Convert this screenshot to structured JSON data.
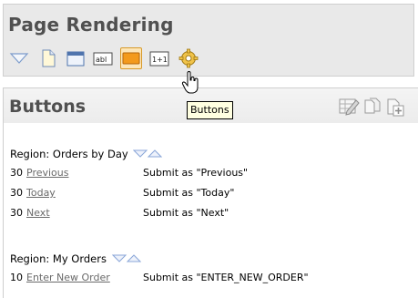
{
  "header": {
    "title": "Page Rendering"
  },
  "toolbar": {
    "items": [
      {
        "icon": "collapse-triangle-icon"
      },
      {
        "icon": "page-icon"
      },
      {
        "icon": "region-icon"
      },
      {
        "icon": "text-field-icon",
        "label": "abl"
      },
      {
        "icon": "button-icon"
      },
      {
        "icon": "computation-icon",
        "label": "1+1"
      },
      {
        "icon": "process-gear-icon"
      }
    ]
  },
  "tooltip": {
    "text": "Buttons"
  },
  "section": {
    "title": "Buttons"
  },
  "regions": [
    {
      "heading": "Region: Orders by Day",
      "buttons": [
        {
          "seq": "30",
          "name": "Previous",
          "action": "Submit as \"Previous\""
        },
        {
          "seq": "30",
          "name": "Today",
          "action": "Submit as \"Today\""
        },
        {
          "seq": "30",
          "name": "Next",
          "action": "Submit as \"Next\""
        }
      ]
    },
    {
      "heading": "Region: My Orders",
      "buttons": [
        {
          "seq": "10",
          "name": "Enter New Order",
          "action": "Submit as \"ENTER_NEW_ORDER\""
        }
      ]
    }
  ],
  "colors": {
    "accent_orange": "#f5a623",
    "link_gray": "#6a6a6a",
    "title_gray": "#505050",
    "arrow_blue": "#8aa6d8"
  }
}
